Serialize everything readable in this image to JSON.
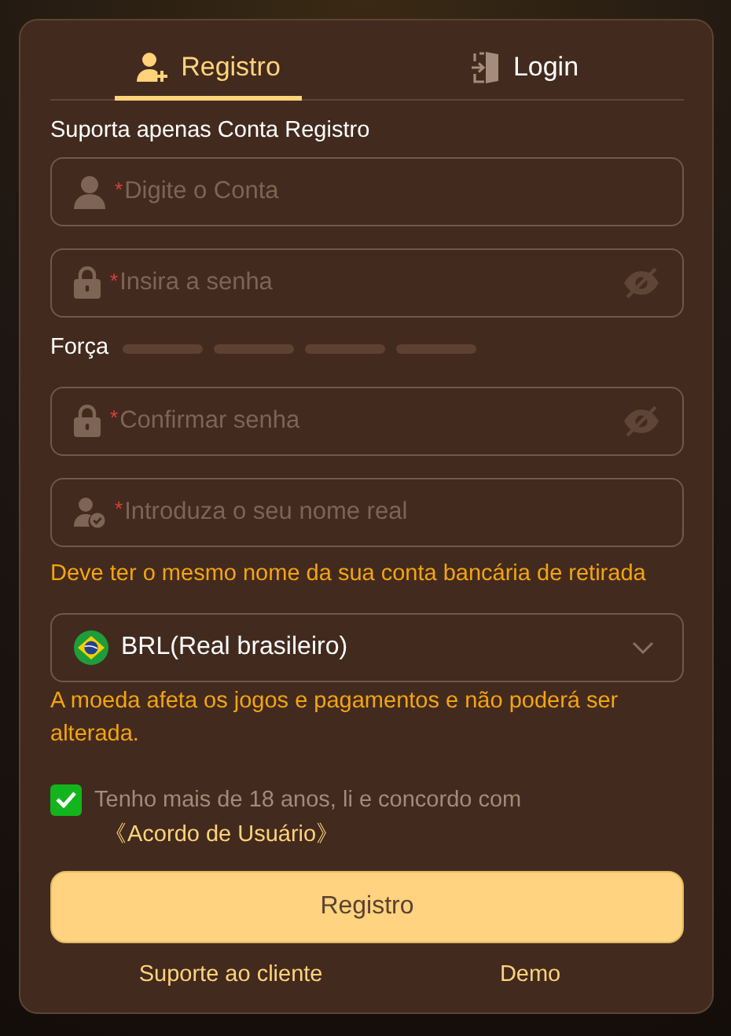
{
  "tabs": [
    {
      "label": "Registro",
      "kind": "register",
      "selected": true
    },
    {
      "label": "Login",
      "kind": "login",
      "selected": false
    }
  ],
  "form": [
    {
      "kind": "note",
      "text": "Suporta apenas Conta Registro"
    },
    {
      "kind": "account",
      "mark": "*",
      "placeholder": "Digite o Conta"
    },
    {
      "kind": "password",
      "mark": "*",
      "placeholder": "Insira a senha"
    },
    {
      "kind": "strength",
      "label": "Força"
    },
    {
      "kind": "password",
      "mark": "*",
      "placeholder": "Confirmar senha"
    },
    {
      "kind": "realname",
      "mark": "*",
      "placeholder": "Introduza o seu nome real"
    },
    {
      "kind": "hint",
      "text": "Deve ter o mesmo nome da sua conta bancária de retirada"
    },
    {
      "kind": "currency",
      "value": "BRL(Real brasileiro)"
    },
    {
      "kind": "hint",
      "text": "A moeda afeta os jogos e pagamentos e não poderá ser alterada."
    },
    {
      "kind": "agreement",
      "checked": true,
      "text": "Tenho mais de 18 anos, li e concordo com",
      "link": "《Acordo de Usuário》"
    }
  ],
  "submit": "Registro",
  "footer_links": [
    "Suporte ao cliente",
    "Demo"
  ]
}
